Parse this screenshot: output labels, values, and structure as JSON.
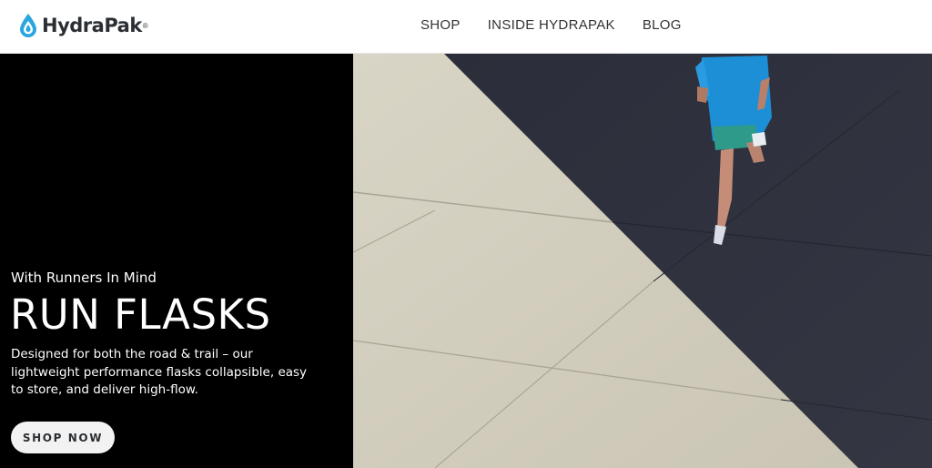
{
  "brand": {
    "name": "HydraPak",
    "registered_mark": "®",
    "accent": "#2aa6df",
    "text_color": "#2b2f33"
  },
  "nav": {
    "items": [
      {
        "label": "SHOP"
      },
      {
        "label": "INSIDE HYDRAPAK"
      },
      {
        "label": "BLOG"
      }
    ]
  },
  "hero": {
    "eyebrow": "With Runners In Mind",
    "headline": "RUN FLASKS",
    "description": "Designed for both the road & trail – our lightweight performance flasks collapsible, easy to store, and deliver high-flow.",
    "cta_label": "SHOP NOW",
    "left_panel_color": "#000000",
    "image_icon": "runner-on-pavement-photo"
  }
}
